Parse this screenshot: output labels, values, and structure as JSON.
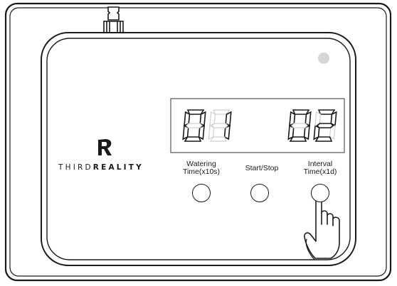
{
  "brand": {
    "prefix": "THIRD",
    "suffix": "REALITY"
  },
  "display": {
    "left_value": "01",
    "right_value": "02"
  },
  "buttons": [
    {
      "label_line1": "Watering",
      "label_line2": "Time(x10s)"
    },
    {
      "label_line1": "Start/Stop",
      "label_line2": ""
    },
    {
      "label_line1": "Interval",
      "label_line2": "Time(x1d)"
    }
  ]
}
